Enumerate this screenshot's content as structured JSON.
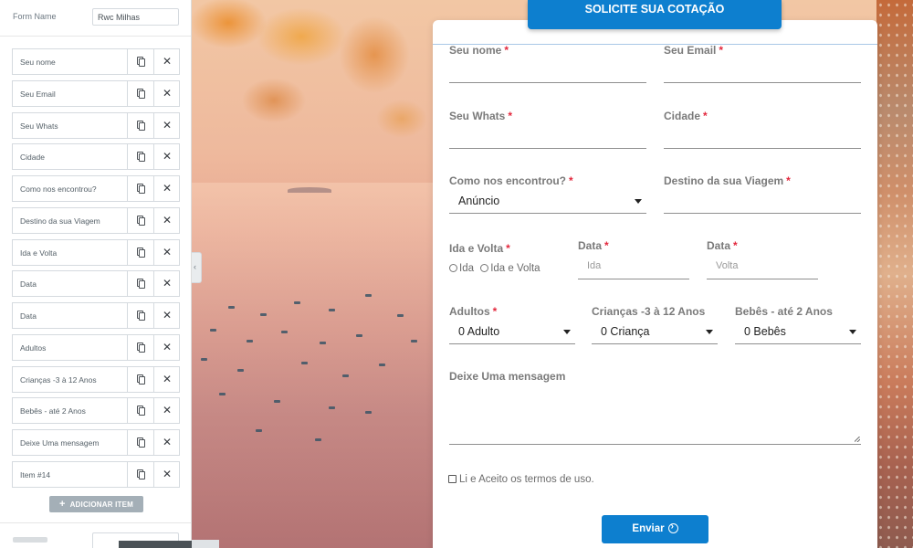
{
  "editor": {
    "form_name_label": "Form Name",
    "form_name_value": "Rwc Milhas",
    "items": [
      {
        "label": "Seu nome"
      },
      {
        "label": "Seu Email"
      },
      {
        "label": "Seu Whats"
      },
      {
        "label": "Cidade"
      },
      {
        "label": "Como nos encontrou?"
      },
      {
        "label": "Destino da sua Viagem"
      },
      {
        "label": "Ida e Volta"
      },
      {
        "label": "Data"
      },
      {
        "label": "Data"
      },
      {
        "label": "Adultos"
      },
      {
        "label": "Crianças -3 à 12 Anos"
      },
      {
        "label": "Bebês - até 2 Anos"
      },
      {
        "label": "Deixe Uma mensagem"
      },
      {
        "label": "Item #14"
      }
    ],
    "add_item_label": "ADICIONAR ITEM"
  },
  "form": {
    "header_title": "SOLICITE SUA COTAÇÃO",
    "required_mark": "*",
    "fields": {
      "name": {
        "label": "Seu nome"
      },
      "email": {
        "label": "Seu Email"
      },
      "whats": {
        "label": "Seu Whats"
      },
      "city": {
        "label": "Cidade"
      },
      "found_us": {
        "label": "Como nos encontrou?",
        "value": "Anúncio"
      },
      "destination": {
        "label": "Destino da sua Viagem"
      },
      "round_trip": {
        "label": "Ida e Volta",
        "options": [
          "Ida",
          "Ida e Volta"
        ]
      },
      "date1": {
        "label": "Data",
        "placeholder": "Ida"
      },
      "date2": {
        "label": "Data",
        "placeholder": "Volta"
      },
      "adults": {
        "label": "Adultos",
        "value": "0 Adulto"
      },
      "children": {
        "label": "Crianças -3 à 12 Anos",
        "value": "0 Criança"
      },
      "babies": {
        "label": "Bebês - até 2 Anos",
        "value": "0 Bebês"
      },
      "message": {
        "label": "Deixe Uma mensagem"
      }
    },
    "terms_label": "Li e Aceito os termos de uso.",
    "submit_label": "Enviar"
  },
  "colors": {
    "brand_blue": "#0d7fcf",
    "required_red": "#e3283d"
  }
}
